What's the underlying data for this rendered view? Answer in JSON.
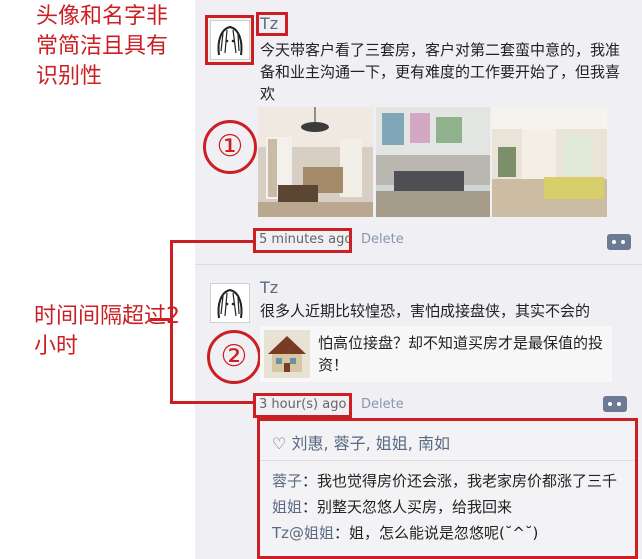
{
  "annotations": {
    "avatar_note": "头像和名字非常简洁且具有识别性",
    "time_note": "时间间隔超过2小时",
    "marker1": "①",
    "marker2": "②"
  },
  "post1": {
    "name": "Tz",
    "text": "今天带客户看了三套房，客户对第二套蛮中意的，我准备和业主沟通一下，更有难度的工作要开始了，但我喜欢",
    "time": "5 minutes ago",
    "delete": "Delete",
    "images": [
      "living-room-photo",
      "sofa-room-photo",
      "open-plan-photo"
    ]
  },
  "post2": {
    "name": "Tz",
    "text": "很多人近期比较惶恐，害怕成接盘侠，其实不会的",
    "share_text": "怕高位接盘？却不知道买房才是最保值的投资！",
    "time": "3 hour(s) ago",
    "delete": "Delete",
    "likes": "刘惠, 蓉子, 姐姐, 南如",
    "comments": [
      {
        "who": "蓉子",
        "text": "：我也觉得房价还会涨，我老家房价都涨了三千"
      },
      {
        "who": "姐姐",
        "text": "：别整天忽悠人买房，给我回来"
      },
      {
        "who": "Tz@姐姐",
        "text": "：姐，怎么能说是忽悠呢(˘^˘)"
      }
    ]
  },
  "colors": {
    "accent_red": "#cc1f24",
    "name_blue": "#5a6a82",
    "feed_bg": "#efeff4"
  }
}
